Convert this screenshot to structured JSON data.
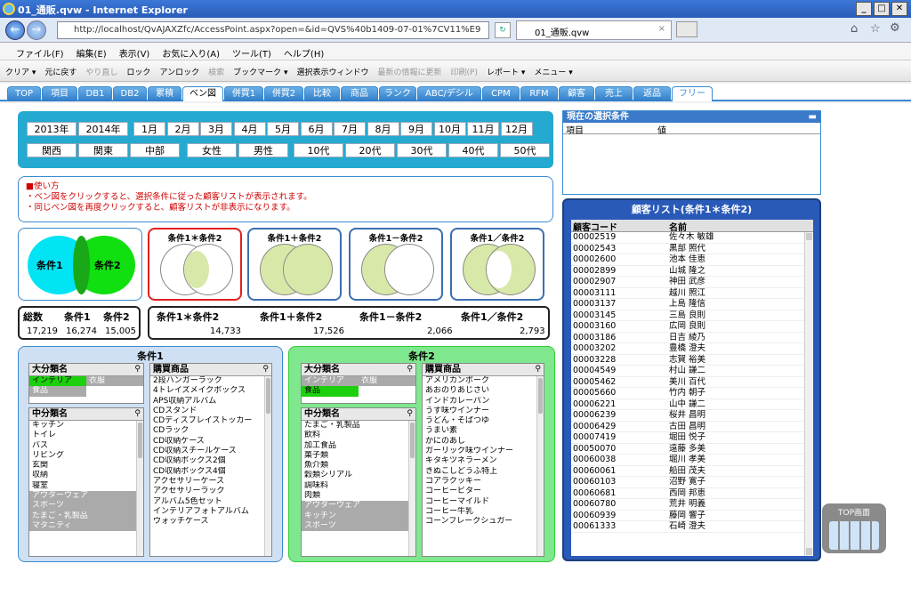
{
  "window": {
    "title": "01_通販.qvw - Internet Explorer",
    "url": "http://localhost/QvAJAXZfc/AccessPoint.aspx?open=&id=QVS%40b1409-07-01%7CV11%E9",
    "tab_title": "01_通販.qvw"
  },
  "ie_menu": [
    "ファイル(F)",
    "編集(E)",
    "表示(V)",
    "お気に入り(A)",
    "ツール(T)",
    "ヘルプ(H)"
  ],
  "qv_toolbar": [
    {
      "label": "クリア ▾",
      "dim": false
    },
    {
      "label": "元に戻す",
      "dim": false
    },
    {
      "label": "やり直し",
      "dim": true
    },
    {
      "label": "ロック",
      "dim": false
    },
    {
      "label": "アンロック",
      "dim": false
    },
    {
      "label": "検索",
      "dim": true
    },
    {
      "label": "ブックマーク ▾",
      "dim": false
    },
    {
      "label": "選択表示ウィンドウ",
      "dim": false
    },
    {
      "label": "最新の情報に更新",
      "dim": true
    },
    {
      "label": "印刷(P)",
      "dim": true
    },
    {
      "label": "レポート ▾",
      "dim": false
    },
    {
      "label": "メニュー ▾",
      "dim": false
    }
  ],
  "sheet_tabs": [
    "TOP",
    "項目",
    "DB1",
    "DB2",
    "累積",
    "ベン図",
    "併買1",
    "併買2",
    "比較",
    "商品",
    "ランク",
    "ABC/デシル",
    "CPM",
    "RFM",
    "顧客",
    "売上",
    "返品",
    "フリー"
  ],
  "filters": {
    "years": [
      "2013年",
      "2014年"
    ],
    "months": [
      "1月",
      "2月",
      "3月",
      "4月",
      "5月",
      "6月",
      "7月",
      "8月",
      "9月",
      "10月",
      "11月",
      "12月"
    ],
    "regions": [
      "関西",
      "関東",
      "中部"
    ],
    "genders": [
      "女性",
      "男性"
    ],
    "ages": [
      "10代",
      "20代",
      "30代",
      "40代",
      "50代"
    ]
  },
  "instructions": {
    "title": "■使い方",
    "line1": "・ベン図をクリックすると、選択条件に従った顧客リストが表示されます。",
    "line2": "・同じベン図を再度クリックすると、顧客リストが非表示になります。"
  },
  "venn": {
    "label1": "条件1",
    "label2": "条件2",
    "cards": [
      "条件1＊条件2",
      "条件1＋条件2",
      "条件1－条件2",
      "条件1／条件2"
    ]
  },
  "totals": {
    "headers": [
      "総数",
      "条件1",
      "条件2"
    ],
    "values": [
      "17,219",
      "16,274",
      "15,005"
    ]
  },
  "combos": {
    "headers": [
      "条件1＊条件2",
      "条件1＋条件2",
      "条件1－条件2",
      "条件1／条件2"
    ],
    "values": [
      "14,733",
      "17,526",
      "2,066",
      "2,793"
    ]
  },
  "cond1": {
    "title": "条件1",
    "major_title": "大分類名",
    "major": [
      {
        "t": "インテリア",
        "s": "sel"
      },
      {
        "t": "衣服",
        "s": "ex"
      },
      {
        "t": "食品",
        "s": "ex"
      }
    ],
    "middle_title": "中分類名",
    "middle": [
      {
        "t": "キッチン",
        "s": ""
      },
      {
        "t": "トイレ",
        "s": ""
      },
      {
        "t": "バス",
        "s": ""
      },
      {
        "t": "リビング",
        "s": ""
      },
      {
        "t": "玄関",
        "s": ""
      },
      {
        "t": "収納",
        "s": ""
      },
      {
        "t": "寝室",
        "s": ""
      },
      {
        "t": "アウターウェア",
        "s": "ex"
      },
      {
        "t": "スポーツ",
        "s": "ex"
      },
      {
        "t": "たまご・乳製品",
        "s": "ex"
      },
      {
        "t": "マタニティ",
        "s": "ex"
      }
    ],
    "product_title": "購買商品",
    "products": [
      "2段ハンガーラック",
      "4トレイズメイクボックス",
      "APS収納アルバム",
      "CDスタンド",
      "CDディスプレイストッカー",
      "CDラック",
      "CD収納ケース",
      "CD収納スチールケース",
      "CD収納ボックス2個",
      "CD収納ボックス4個",
      "アクセサリーケース",
      "アクセサリーラック",
      "アルバム5色セット",
      "インテリアフォトアルバム",
      "ウォッチケース"
    ]
  },
  "cond2": {
    "title": "条件2",
    "major_title": "大分類名",
    "major": [
      {
        "t": "インテリア",
        "s": "ex"
      },
      {
        "t": "衣服",
        "s": "ex"
      },
      {
        "t": "食品",
        "s": "sel"
      }
    ],
    "middle_title": "中分類名",
    "middle": [
      {
        "t": "たまご・乳製品",
        "s": ""
      },
      {
        "t": "飲料",
        "s": ""
      },
      {
        "t": "加工食品",
        "s": ""
      },
      {
        "t": "菓子類",
        "s": ""
      },
      {
        "t": "魚介類",
        "s": ""
      },
      {
        "t": "穀類シリアル",
        "s": ""
      },
      {
        "t": "調味料",
        "s": ""
      },
      {
        "t": "肉類",
        "s": ""
      },
      {
        "t": "アウターウェア",
        "s": "ex"
      },
      {
        "t": "キッチン",
        "s": "ex"
      },
      {
        "t": "スポーツ",
        "s": "ex"
      }
    ],
    "product_title": "購買商品",
    "products": [
      "アメリカンポーク",
      "あおのりあじさい",
      "インドカレーパン",
      "うす味ウインナー",
      "うどん・そばつゆ",
      "うまい素",
      "かにのあし",
      "ガーリック味ウインナー",
      "キタキツネラーメン",
      "きぬこしどうふ特上",
      "コアラクッキー",
      "コーヒービター",
      "コーヒーマイルド",
      "コーヒー牛乳",
      "コーンフレークシュガー"
    ]
  },
  "selection": {
    "title": "現在の選択条件",
    "col1": "項目",
    "col2": "値"
  },
  "customers": {
    "title": "顧客リスト(条件1＊条件2)",
    "col1": "顧客コード",
    "col2": "名前",
    "rows": [
      [
        "00002519",
        "佐々木 敏雄"
      ],
      [
        "00002543",
        "黒部 照代"
      ],
      [
        "00002600",
        "池本 佳恵"
      ],
      [
        "00002899",
        "山城 隆之"
      ],
      [
        "00002907",
        "神田 武彦"
      ],
      [
        "00003111",
        "越川 照江"
      ],
      [
        "00003137",
        "上島 隆信"
      ],
      [
        "00003145",
        "三島 良則"
      ],
      [
        "00003160",
        "広岡 良則"
      ],
      [
        "00003186",
        "日吉 綾乃"
      ],
      [
        "00003202",
        "豊橋 澄夫"
      ],
      [
        "00003228",
        "志賀 裕美"
      ],
      [
        "00004549",
        "村山 謙二"
      ],
      [
        "00005462",
        "美川 百代"
      ],
      [
        "00005660",
        "竹内 朝子"
      ],
      [
        "00006221",
        "山中 謙二"
      ],
      [
        "00006239",
        "桜井 昌明"
      ],
      [
        "00006429",
        "古田 昌明"
      ],
      [
        "00007419",
        "堀田 悦子"
      ],
      [
        "00050070",
        "遠藤 多美"
      ],
      [
        "00060038",
        "堀川 孝美"
      ],
      [
        "00060061",
        "船田 茂夫"
      ],
      [
        "00060103",
        "沼野 寛子"
      ],
      [
        "00060681",
        "西岡 邦恵"
      ],
      [
        "00060780",
        "荒井 明義"
      ],
      [
        "00060939",
        "藤岡 響子"
      ],
      [
        "00061333",
        "石崎 澄夫"
      ]
    ]
  },
  "topbtn": {
    "label": "TOP画面"
  },
  "colors": {
    "tab_blue": "#2e7bc8",
    "cyan": "#24a9d0",
    "selected_green": "#1dd00d",
    "venn_cyan": "#00e4f4",
    "venn_green": "#10e010",
    "venn_olive": "#d8e8a8"
  }
}
